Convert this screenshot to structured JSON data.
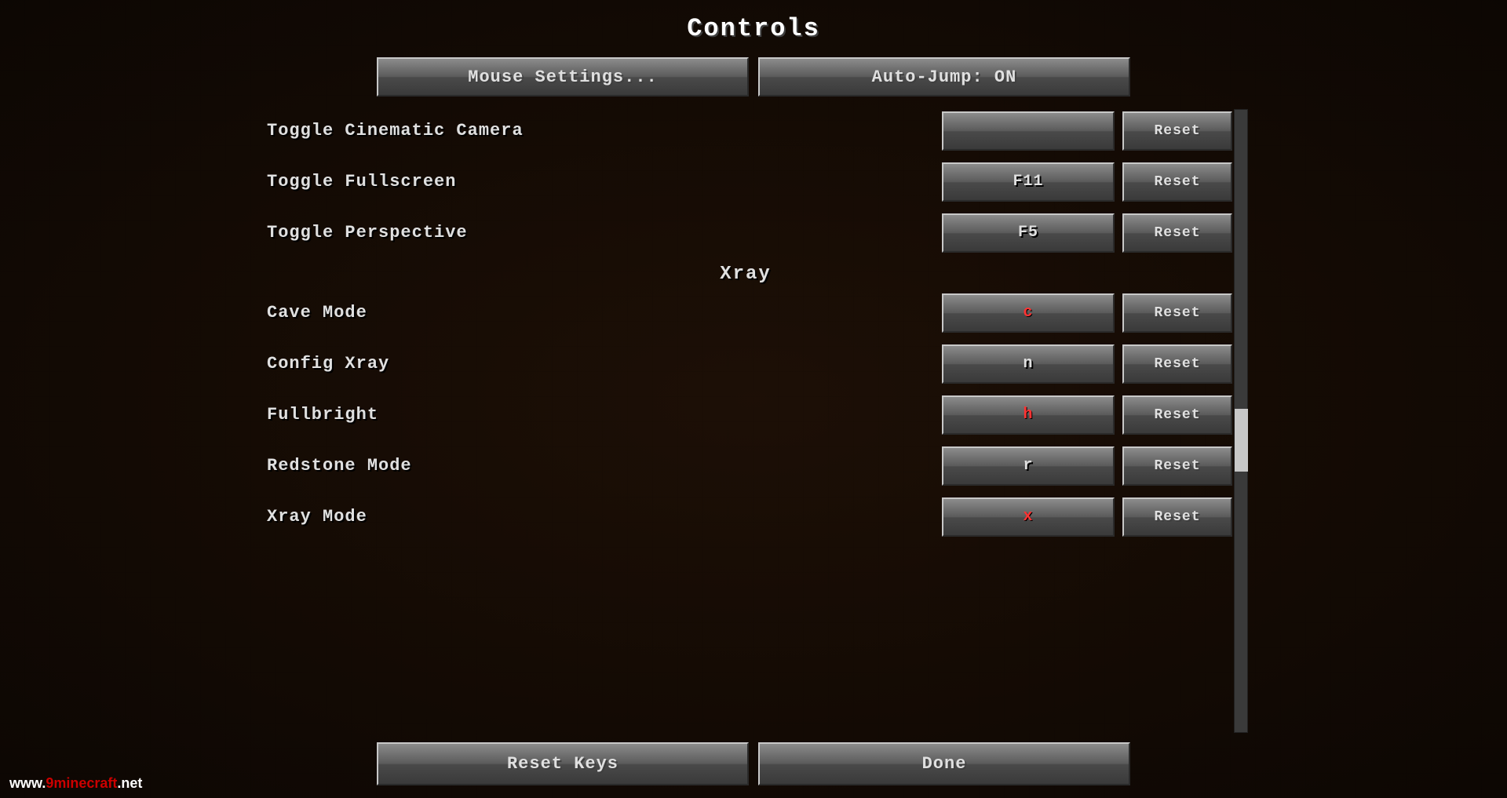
{
  "page": {
    "title": "Controls",
    "background_color": "#1a1008"
  },
  "top_buttons": [
    {
      "id": "mouse-settings",
      "label": "Mouse Settings..."
    },
    {
      "id": "auto-jump",
      "label": "Auto-Jump: ON"
    }
  ],
  "settings": [
    {
      "category": null,
      "label": "Toggle Cinematic Camera",
      "key": "",
      "key_color": "normal",
      "show_reset": true
    },
    {
      "category": null,
      "label": "Toggle Fullscreen",
      "key": "F11",
      "key_color": "normal",
      "show_reset": true
    },
    {
      "category": null,
      "label": "Toggle Perspective",
      "key": "F5",
      "key_color": "normal",
      "show_reset": true
    }
  ],
  "xray_section": {
    "header": "Xray",
    "items": [
      {
        "label": "Cave Mode",
        "key": "c",
        "key_color": "red",
        "show_reset": true
      },
      {
        "label": "Config Xray",
        "key": "n",
        "key_color": "normal",
        "show_reset": true
      },
      {
        "label": "Fullbright",
        "key": "h",
        "key_color": "red",
        "show_reset": true
      },
      {
        "label": "Redstone Mode",
        "key": "r",
        "key_color": "normal",
        "show_reset": true
      },
      {
        "label": "Xray Mode",
        "key": "x",
        "key_color": "red",
        "show_reset": true
      }
    ]
  },
  "bottom_buttons": [
    {
      "id": "reset-keys",
      "label": "Reset Keys"
    },
    {
      "id": "done",
      "label": "Done"
    }
  ],
  "labels": {
    "reset": "Reset"
  },
  "watermark": {
    "full": "www.9minecraft.net",
    "prefix": "www.",
    "brand": "9minecraft",
    "suffix": ".net"
  }
}
